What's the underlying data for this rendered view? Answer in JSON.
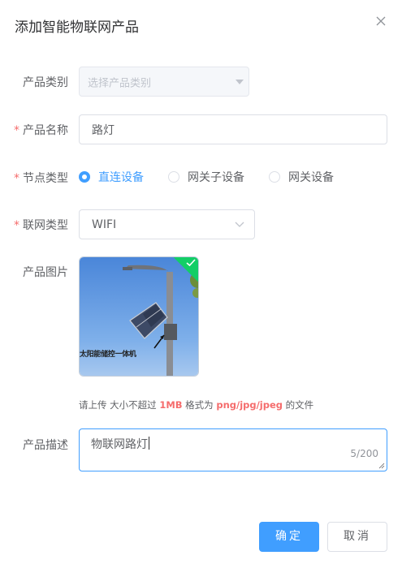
{
  "dialog": {
    "title": "添加智能物联网产品"
  },
  "form": {
    "category": {
      "label": "产品类别",
      "placeholder": "选择产品类别"
    },
    "name": {
      "required_mark": "*",
      "label": "产品名称",
      "value": "路灯"
    },
    "node_type": {
      "required_mark": "*",
      "label": "节点类型",
      "options": [
        {
          "label": "直连设备",
          "selected": true
        },
        {
          "label": "网关子设备",
          "selected": false
        },
        {
          "label": "网关设备",
          "selected": false
        }
      ]
    },
    "network_type": {
      "required_mark": "*",
      "label": "联网类型",
      "value": "WIFI"
    },
    "image": {
      "label": "产品图片",
      "caption": "太阳能储控一体机",
      "hint": {
        "prefix": "请上传 大小不超过 ",
        "size": "1MB",
        "middle": " 格式为 ",
        "formats": "png/jpg/jpeg",
        "suffix": " 的文件"
      }
    },
    "description": {
      "label": "产品描述",
      "value": "物联网路灯",
      "counter": "5/200"
    }
  },
  "buttons": {
    "confirm": "确定",
    "cancel": "取消"
  },
  "colors": {
    "primary": "#409eff",
    "required": "#f56c6c",
    "success_badge": "#13ce66"
  }
}
